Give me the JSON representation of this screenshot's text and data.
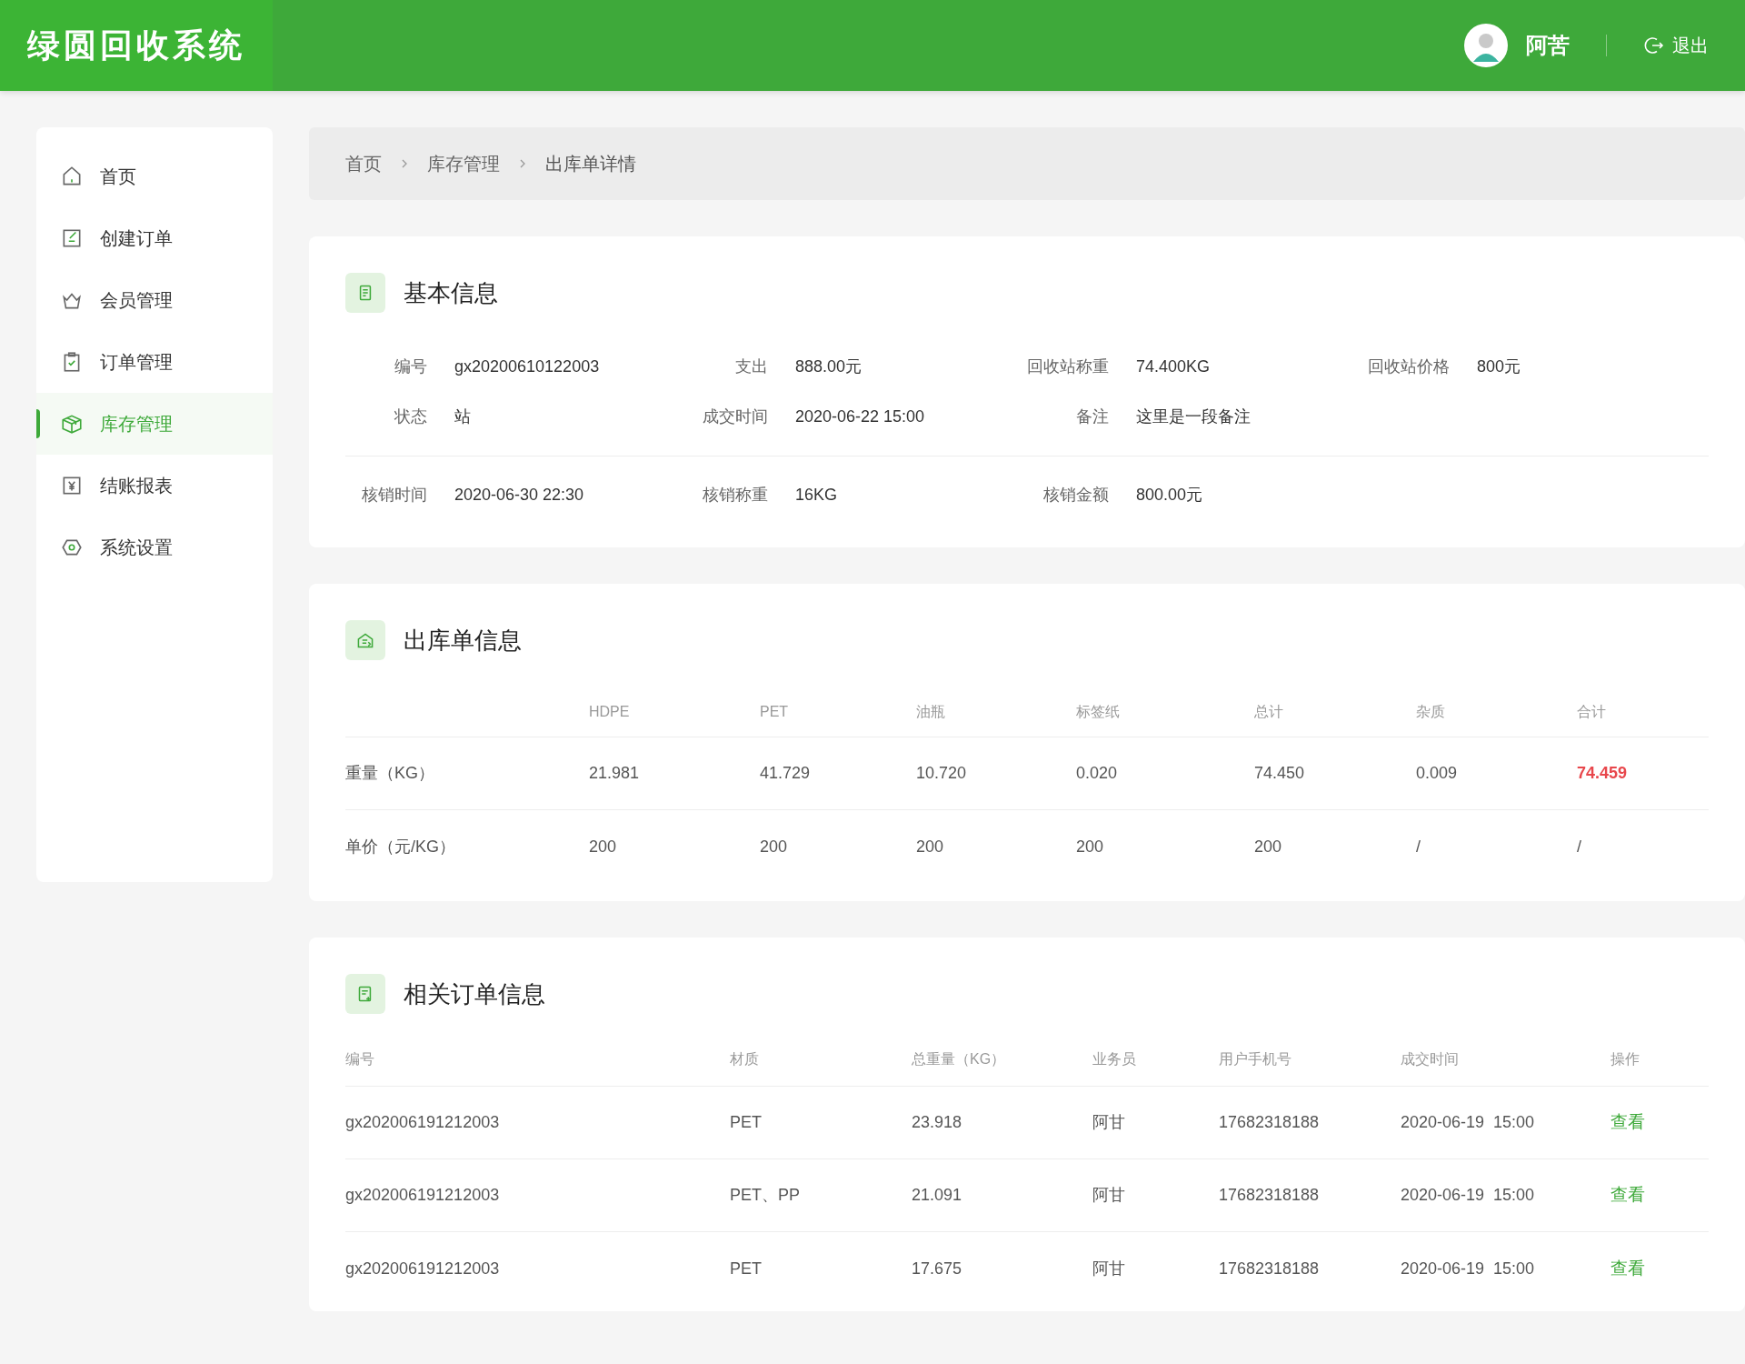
{
  "header": {
    "title": "绿圆回收系统",
    "user": {
      "name": "阿苦"
    },
    "logout": "退出"
  },
  "sidebar": {
    "items": [
      {
        "label": "首页",
        "selected": false
      },
      {
        "label": "创建订单",
        "selected": false
      },
      {
        "label": "会员管理",
        "selected": false
      },
      {
        "label": "订单管理",
        "selected": false
      },
      {
        "label": "库存管理",
        "selected": true
      },
      {
        "label": "结账报表",
        "selected": false
      },
      {
        "label": "系统设置",
        "selected": false
      }
    ]
  },
  "breadcrumb": [
    "首页",
    "库存管理",
    "出库单详情"
  ],
  "basic_info": {
    "title": "基本信息",
    "fields": [
      {
        "label": "编号",
        "value": "gx20200610122003"
      },
      {
        "label": "支出",
        "value": "888.00元"
      },
      {
        "label": "回收站称重",
        "value": "74.400KG"
      },
      {
        "label": "回收站价格",
        "value": "800元"
      },
      {
        "label": "状态",
        "value": "站"
      },
      {
        "label": "成交时间",
        "value": "2020-06-22 15:00"
      },
      {
        "label": "备注",
        "value": "这里是一段备注"
      }
    ],
    "verification": [
      {
        "label": "核销时间",
        "value": "2020-06-30 22:30"
      },
      {
        "label": "核销称重",
        "value": "16KG"
      },
      {
        "label": "核销金额",
        "value": "800.00元"
      }
    ]
  },
  "outbound": {
    "title": "出库单信息",
    "columns": [
      "HDPE",
      "PET",
      "油瓶",
      "标签纸",
      "总计",
      "杂质",
      "合计"
    ],
    "rows": [
      {
        "label": "重量（KG）",
        "cells": [
          "21.981",
          "41.729",
          "10.720",
          "0.020",
          "74.450",
          "0.009",
          "74.459"
        ],
        "highlight_last": true
      },
      {
        "label": "单价（元/KG）",
        "cells": [
          "200",
          "200",
          "200",
          "200",
          "200",
          "/",
          "/"
        ],
        "highlight_last": false
      }
    ]
  },
  "related_orders": {
    "title": "相关订单信息",
    "columns": [
      "编号",
      "材质",
      "总重量（KG）",
      "业务员",
      "用户手机号",
      "成交时间",
      "操作"
    ],
    "rows": [
      {
        "id": "gx202006191212003",
        "material": "PET",
        "weight": "23.918",
        "clerk": "阿甘",
        "phone": "17682318188",
        "time": "2020-06-19  15:00",
        "action": "查看"
      },
      {
        "id": "gx202006191212003",
        "material": "PET、PP",
        "weight": "21.091",
        "clerk": "阿甘",
        "phone": "17682318188",
        "time": "2020-06-19  15:00",
        "action": "查看"
      },
      {
        "id": "gx202006191212003",
        "material": "PET",
        "weight": "17.675",
        "clerk": "阿甘",
        "phone": "17682318188",
        "time": "2020-06-19  15:00",
        "action": "查看"
      }
    ]
  }
}
